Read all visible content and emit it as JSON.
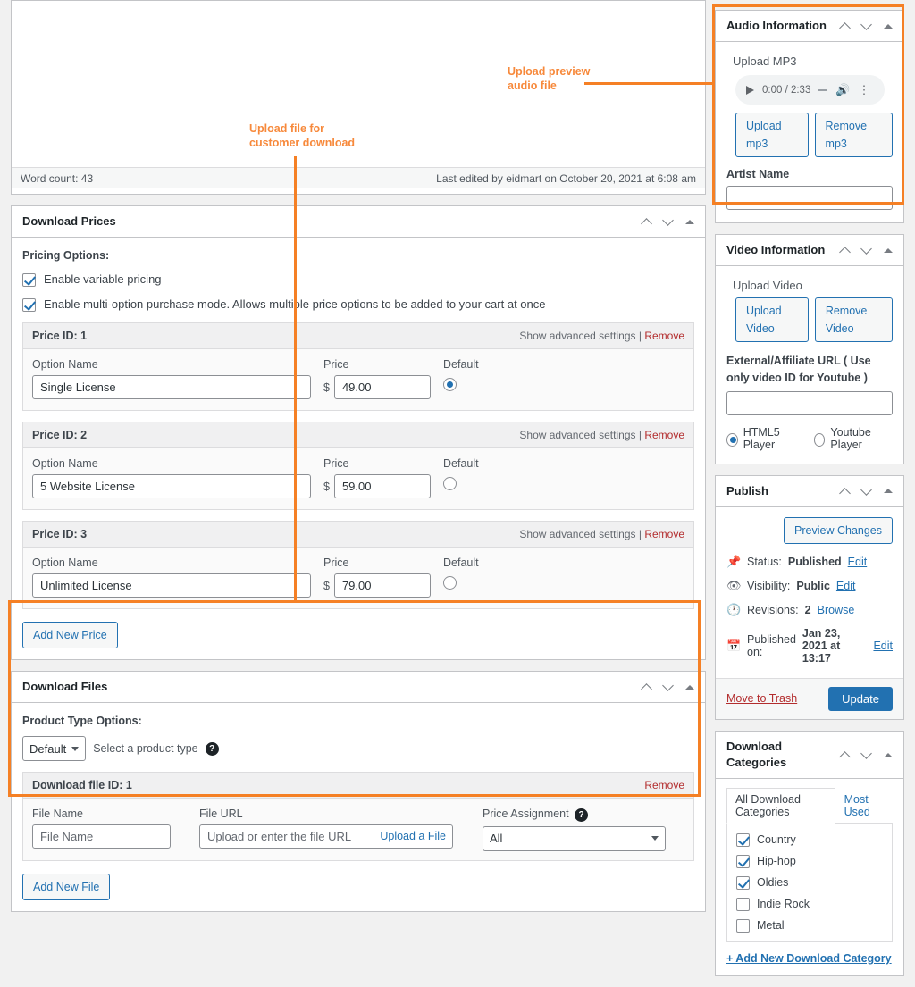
{
  "editor": {
    "word_count": "Word count: 43",
    "last_edited": "Last edited by eidmart on October 20, 2021 at 6:08 am"
  },
  "download_prices": {
    "title": "Download Prices",
    "pricing_options_label": "Pricing Options:",
    "checkboxes": [
      {
        "label": "Enable variable pricing",
        "checked": true
      },
      {
        "label": "Enable multi-option purchase mode. Allows multiple price options to be added to your cart at once",
        "checked": true
      }
    ],
    "col_option_name": "Option Name",
    "col_price": "Price",
    "col_default": "Default",
    "currency": "$",
    "advanced_label": "Show advanced settings",
    "separator": "|",
    "remove_label": "Remove",
    "rows": [
      {
        "id_label": "Price ID: 1",
        "option_name": "Single License",
        "price": "49.00",
        "is_default": true
      },
      {
        "id_label": "Price ID: 2",
        "option_name": "5 Website License",
        "price": "59.00",
        "is_default": false
      },
      {
        "id_label": "Price ID: 3",
        "option_name": "Unlimited License",
        "price": "79.00",
        "is_default": false
      }
    ],
    "add_new_price": "Add New Price"
  },
  "download_files": {
    "title": "Download Files",
    "product_type_label": "Product Type Options:",
    "product_type_value": "Default",
    "product_type_hint": "Select a product type",
    "file_id_label": "Download file ID: 1",
    "remove_label": "Remove",
    "file_name_label": "File Name",
    "file_name_placeholder": "File Name",
    "file_url_label": "File URL",
    "file_url_placeholder": "Upload or enter the file URL",
    "upload_a_file": "Upload a File",
    "price_assignment_label": "Price Assignment",
    "price_assignment_value": "All",
    "add_new_file": "Add New File"
  },
  "audio_information": {
    "title": "Audio Information",
    "upload_mp3_label": "Upload MP3",
    "player_time": "0:00 / 2:33",
    "upload_button": "Upload mp3",
    "remove_button": "Remove mp3",
    "artist_name_label": "Artist Name",
    "artist_name_value": ""
  },
  "video_information": {
    "title": "Video Information",
    "upload_video_label": "Upload Video",
    "upload_button": "Upload Video",
    "remove_button": "Remove Video",
    "external_url_label": "External/Affiliate URL ( Use only video ID for Youtube )",
    "external_url_value": "",
    "player_options": [
      {
        "label": "HTML5 Player",
        "selected": true
      },
      {
        "label": "Youtube Player",
        "selected": false
      }
    ]
  },
  "publish": {
    "title": "Publish",
    "preview_changes": "Preview Changes",
    "status_label": "Status:",
    "status_value": "Published",
    "status_edit": "Edit",
    "visibility_label": "Visibility:",
    "visibility_value": "Public",
    "visibility_edit": "Edit",
    "revisions_label": "Revisions:",
    "revisions_value": "2",
    "revisions_browse": "Browse",
    "published_label": "Published on:",
    "published_value": "Jan 23, 2021 at 13:17",
    "published_edit": "Edit",
    "move_to_trash": "Move to Trash",
    "update": "Update"
  },
  "download_categories": {
    "title": "Download Categories",
    "tabs": [
      {
        "label": "All Download Categories",
        "active": true
      },
      {
        "label": "Most Used",
        "active": false
      }
    ],
    "items": [
      {
        "label": "Country",
        "checked": true
      },
      {
        "label": "Hip-hop",
        "checked": true
      },
      {
        "label": "Oldies",
        "checked": true
      },
      {
        "label": "Indie Rock",
        "checked": false
      },
      {
        "label": "Metal",
        "checked": false
      }
    ],
    "add_new": "+ Add New Download Category"
  },
  "annotations": {
    "accent_color": "#f58025",
    "audio_note": "Upload preview\naudio file",
    "files_note": "Upload file for\ncustomer download"
  }
}
